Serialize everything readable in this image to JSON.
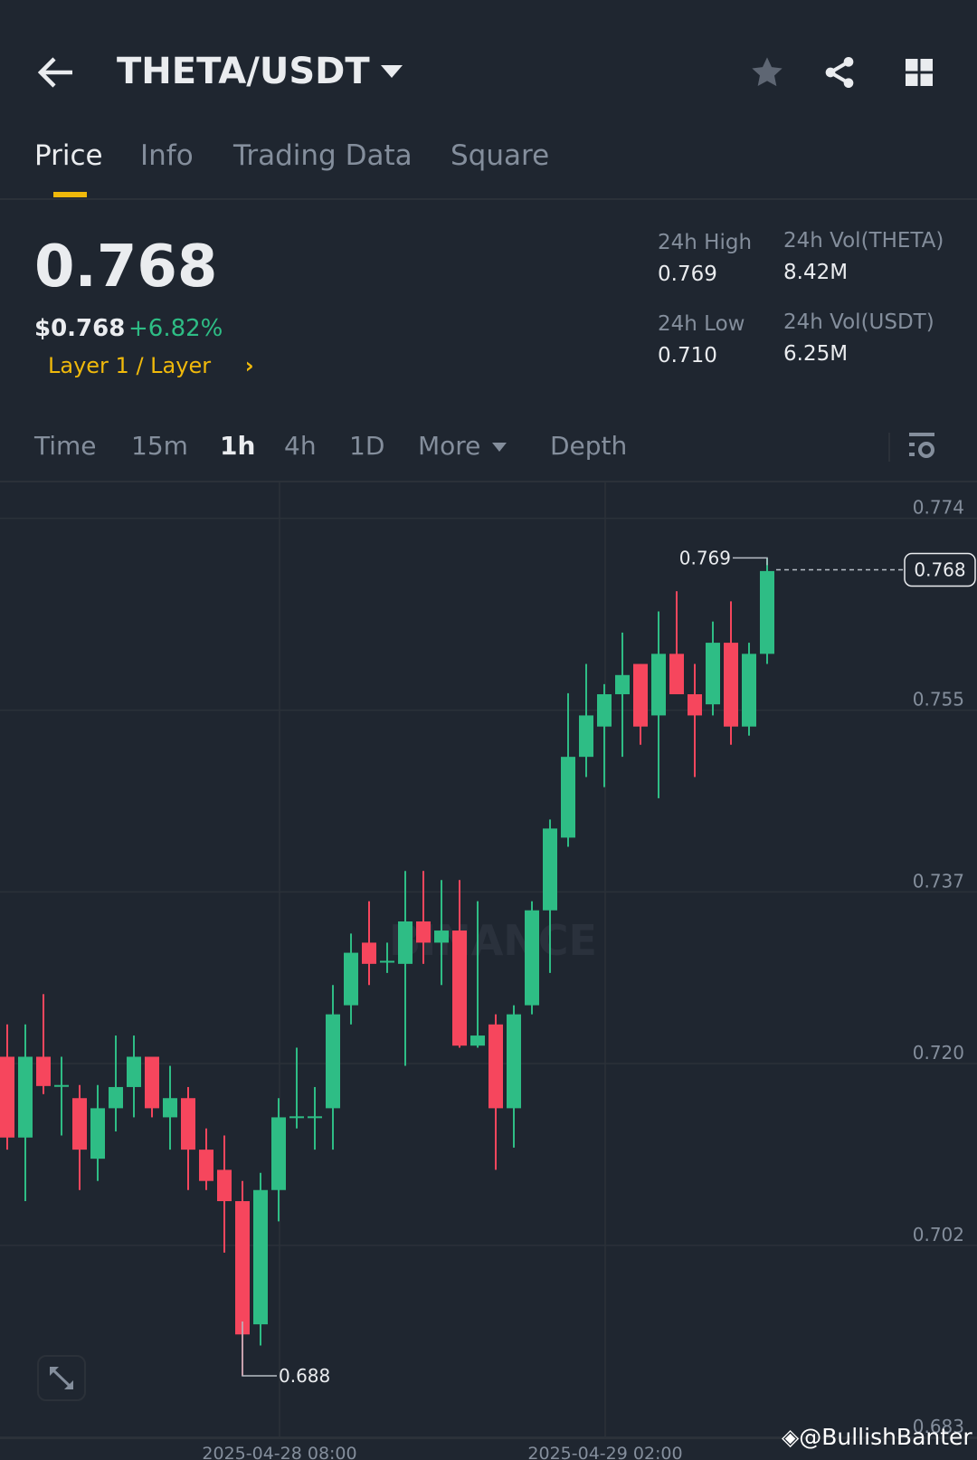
{
  "header": {
    "title": "THETA/USDT"
  },
  "tabs": [
    {
      "label": "Price"
    },
    {
      "label": "Info"
    },
    {
      "label": "Trading Data"
    },
    {
      "label": "Square"
    }
  ],
  "price": {
    "last": "0.768",
    "usd": "$0.768",
    "change": "+6.82%",
    "category": "Layer 1 / Layer"
  },
  "stats": {
    "high_label": "24h High",
    "high": "0.769",
    "low_label": "24h Low",
    "low": "0.710",
    "vol_base_label": "24h Vol(THETA)",
    "vol_base": "8.42M",
    "vol_quote_label": "24h Vol(USDT)",
    "vol_quote": "6.25M"
  },
  "intervals": {
    "time": "Time",
    "m15": "15m",
    "h1": "1h",
    "h4": "4h",
    "d1": "1D",
    "more": "More",
    "depth": "Depth"
  },
  "colors": {
    "up": "#2ebd85",
    "down": "#f6465d",
    "accent": "#f0b90b",
    "bg": "#1f2630"
  },
  "watermark": {
    "brand": "BINANCE",
    "credit": "@BullishBanter"
  },
  "chart_data": {
    "type": "candlestick",
    "interval": "1h",
    "ylim": [
      0.683,
      0.774
    ],
    "y_ticks": [
      "0.774",
      "0.755",
      "0.737",
      "0.720",
      "0.702",
      "0.683"
    ],
    "x_ticks": [
      "2025-04-28 08:00",
      "2025-04-29 02:00"
    ],
    "last_price_label": "0.768",
    "high_label": "0.769",
    "low_label": "0.688",
    "ohlc": [
      [
        0.7196,
        0.7228,
        0.7104,
        0.7116
      ],
      [
        0.7116,
        0.7228,
        0.7053,
        0.7196
      ],
      [
        0.7196,
        0.7258,
        0.7159,
        0.7167
      ],
      [
        0.7167,
        0.7196,
        0.7118,
        0.7168
      ],
      [
        0.7155,
        0.7168,
        0.7064,
        0.7104
      ],
      [
        0.7095,
        0.7168,
        0.7073,
        0.7145
      ],
      [
        0.7145,
        0.7217,
        0.7122,
        0.7166
      ],
      [
        0.7166,
        0.7217,
        0.7136,
        0.7196
      ],
      [
        0.7196,
        0.7196,
        0.7136,
        0.7145
      ],
      [
        0.7136,
        0.7187,
        0.7104,
        0.7155
      ],
      [
        0.7155,
        0.7166,
        0.7064,
        0.7104
      ],
      [
        0.7104,
        0.7125,
        0.7064,
        0.7073
      ],
      [
        0.7084,
        0.7118,
        0.7002,
        0.7053
      ],
      [
        0.7053,
        0.7073,
        0.688,
        0.6921
      ],
      [
        0.6931,
        0.7081,
        0.691,
        0.7064
      ],
      [
        0.7064,
        0.7155,
        0.7033,
        0.7136
      ],
      [
        0.7136,
        0.7205,
        0.7125,
        0.7137
      ],
      [
        0.7136,
        0.7166,
        0.7104,
        0.7137
      ],
      [
        0.7145,
        0.7267,
        0.7104,
        0.7238
      ],
      [
        0.7247,
        0.7318,
        0.7228,
        0.7299
      ],
      [
        0.7309,
        0.735,
        0.7267,
        0.7288
      ],
      [
        0.729,
        0.7309,
        0.7279,
        0.7291
      ],
      [
        0.7288,
        0.738,
        0.7187,
        0.733
      ],
      [
        0.733,
        0.738,
        0.7288,
        0.7309
      ],
      [
        0.7309,
        0.7371,
        0.7267,
        0.7321
      ],
      [
        0.7321,
        0.7371,
        0.7205,
        0.7207
      ],
      [
        0.7207,
        0.735,
        0.7205,
        0.7217
      ],
      [
        0.7228,
        0.7238,
        0.7084,
        0.7145
      ],
      [
        0.7145,
        0.7247,
        0.7106,
        0.7238
      ],
      [
        0.7247,
        0.735,
        0.7238,
        0.7341
      ],
      [
        0.7341,
        0.7431,
        0.7279,
        0.7422
      ],
      [
        0.7413,
        0.7556,
        0.7404,
        0.7493
      ],
      [
        0.7493,
        0.7585,
        0.7473,
        0.7534
      ],
      [
        0.7523,
        0.7565,
        0.7463,
        0.7555
      ],
      [
        0.7555,
        0.7616,
        0.7493,
        0.7574
      ],
      [
        0.7585,
        0.7585,
        0.7505,
        0.7523
      ],
      [
        0.7534,
        0.7637,
        0.7452,
        0.7595
      ],
      [
        0.7595,
        0.7657,
        0.7555,
        0.7555
      ],
      [
        0.7555,
        0.7585,
        0.7473,
        0.7534
      ],
      [
        0.7545,
        0.7627,
        0.7534,
        0.7606
      ],
      [
        0.7606,
        0.7647,
        0.7505,
        0.7523
      ],
      [
        0.7523,
        0.7606,
        0.7514,
        0.7595
      ],
      [
        0.7595,
        0.769,
        0.7585,
        0.7677
      ]
    ]
  }
}
